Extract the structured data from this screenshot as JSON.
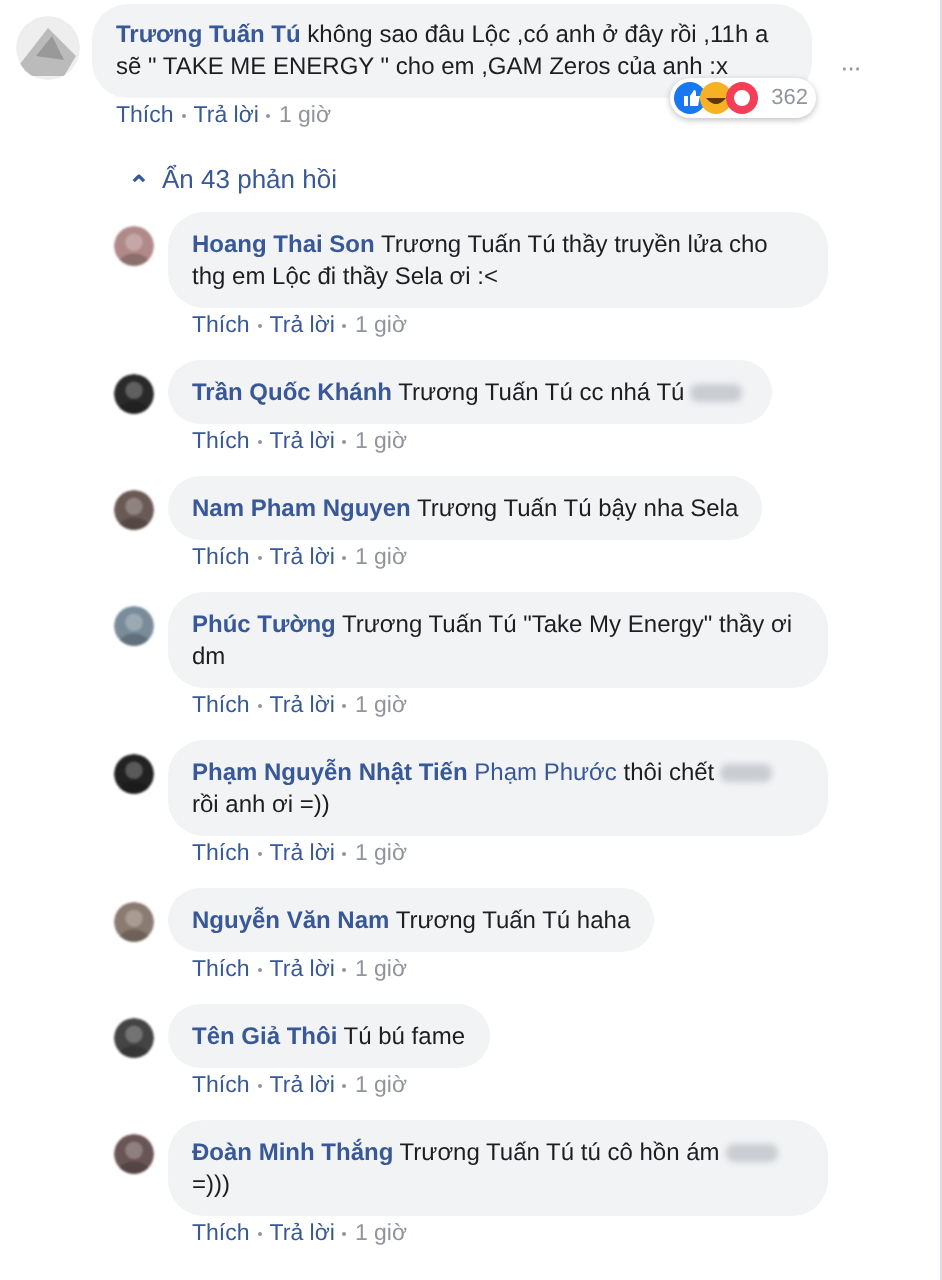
{
  "comment": {
    "author": "Trương Tuấn Tú",
    "parts": [
      {
        "kind": "text",
        "text": "không sao đâu Lộc ,có anh ở đây rồi ,11h a sẽ \" TAKE ME ENERGY \" cho em ,GAM Zeros của anh :x"
      }
    ],
    "reaction_count": "362",
    "actions": [
      "Thích",
      "Trả lời",
      "1 giờ"
    ],
    "more": "···"
  },
  "replies_toggle": {
    "icon": "⌃",
    "label": "Ẩn 43 phản hồi"
  },
  "replies": [
    {
      "author": "Hoang Thai Son",
      "parts": [
        {
          "kind": "text",
          "text": "Trương Tuấn Tú thầy truyền lửa cho thg em Lộc đi thầy Sela ơi :<"
        }
      ],
      "actions": [
        "Thích",
        "Trả lời",
        "1 giờ"
      ]
    },
    {
      "author": "Trần Quốc Khánh",
      "parts": [
        {
          "kind": "text",
          "text": "Trương Tuấn Tú cc nhá Tú"
        },
        {
          "kind": "blur"
        }
      ],
      "actions": [
        "Thích",
        "Trả lời",
        "1 giờ"
      ]
    },
    {
      "author": "Nam Pham Nguyen",
      "parts": [
        {
          "kind": "text",
          "text": "Trương Tuấn Tú bậy nha Sela"
        }
      ],
      "actions": [
        "Thích",
        "Trả lời",
        "1 giờ"
      ]
    },
    {
      "author": "Phúc Tường",
      "parts": [
        {
          "kind": "text",
          "text": "Trương Tuấn Tú \"Take My Energy\" thầy ơi dm"
        }
      ],
      "actions": [
        "Thích",
        "Trả lời",
        "1 giờ"
      ]
    },
    {
      "author": "Phạm Nguyễn Nhật Tiến",
      "parts": [
        {
          "kind": "link",
          "text": "Phạm Phước"
        },
        {
          "kind": "text",
          "text": "thôi chết"
        },
        {
          "kind": "blur"
        },
        {
          "kind": "text",
          "text": "rồi anh ơi =))"
        }
      ],
      "actions": [
        "Thích",
        "Trả lời",
        "1 giờ"
      ]
    },
    {
      "author": "Nguyễn Văn Nam",
      "parts": [
        {
          "kind": "text",
          "text": "Trương Tuấn Tú haha"
        }
      ],
      "actions": [
        "Thích",
        "Trả lời",
        "1 giờ"
      ]
    },
    {
      "author": "Tên Giả Thôi",
      "parts": [
        {
          "kind": "text",
          "text": "Tú bú fame"
        }
      ],
      "actions": [
        "Thích",
        "Trả lời",
        "1 giờ"
      ]
    },
    {
      "author": "Đoàn Minh Thắng",
      "parts": [
        {
          "kind": "text",
          "text": "Trương Tuấn Tú tú cô hồn ám"
        },
        {
          "kind": "blur"
        },
        {
          "kind": "text",
          "text": "=)))"
        }
      ],
      "actions": [
        "Thích",
        "Trả lời",
        "1 giờ"
      ]
    }
  ]
}
